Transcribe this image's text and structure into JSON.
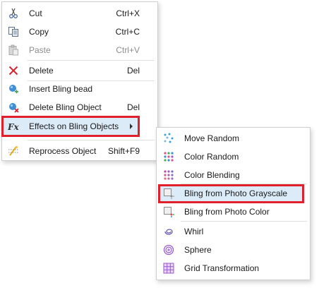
{
  "context_menu": {
    "items": [
      {
        "label": "Cut",
        "shortcut": "Ctrl+X",
        "icon": "scissors-icon"
      },
      {
        "label": "Copy",
        "shortcut": "Ctrl+C",
        "icon": "copy-icon"
      },
      {
        "label": "Paste",
        "shortcut": "Ctrl+V",
        "icon": "paste-icon",
        "disabled": true
      },
      {
        "label": "Delete",
        "shortcut": "Del",
        "icon": "delete-x-icon"
      },
      {
        "label": "Insert Bling bead",
        "shortcut": "",
        "icon": "insert-bead-icon"
      },
      {
        "label": "Delete Bling Object",
        "shortcut": "Del",
        "icon": "delete-object-icon"
      },
      {
        "label": "Effects on Bling Objects",
        "shortcut": "",
        "icon": "fx-icon",
        "has_submenu": true,
        "highlighted": true
      },
      {
        "label": "Reprocess Object",
        "shortcut": "Shift+F9",
        "icon": "reprocess-icon"
      }
    ]
  },
  "effects_submenu": {
    "items": [
      {
        "label": "Move Random",
        "icon": "move-random-icon"
      },
      {
        "label": "Color Random",
        "icon": "color-random-icon"
      },
      {
        "label": "Color Blending",
        "icon": "color-blending-icon"
      },
      {
        "label": "Bling from Photo Grayscale",
        "icon": "photo-grayscale-icon",
        "highlighted": true
      },
      {
        "label": "Bling from Photo Color",
        "icon": "photo-color-icon"
      },
      {
        "label": "Whirl",
        "icon": "whirl-icon"
      },
      {
        "label": "Sphere",
        "icon": "sphere-icon"
      },
      {
        "label": "Grid Transformation",
        "icon": "grid-transformation-icon"
      }
    ]
  },
  "colors": {
    "highlight_border": "#e0202b",
    "highlight_fill": "#dcebf8",
    "disabled_text": "#8c8c8c"
  }
}
